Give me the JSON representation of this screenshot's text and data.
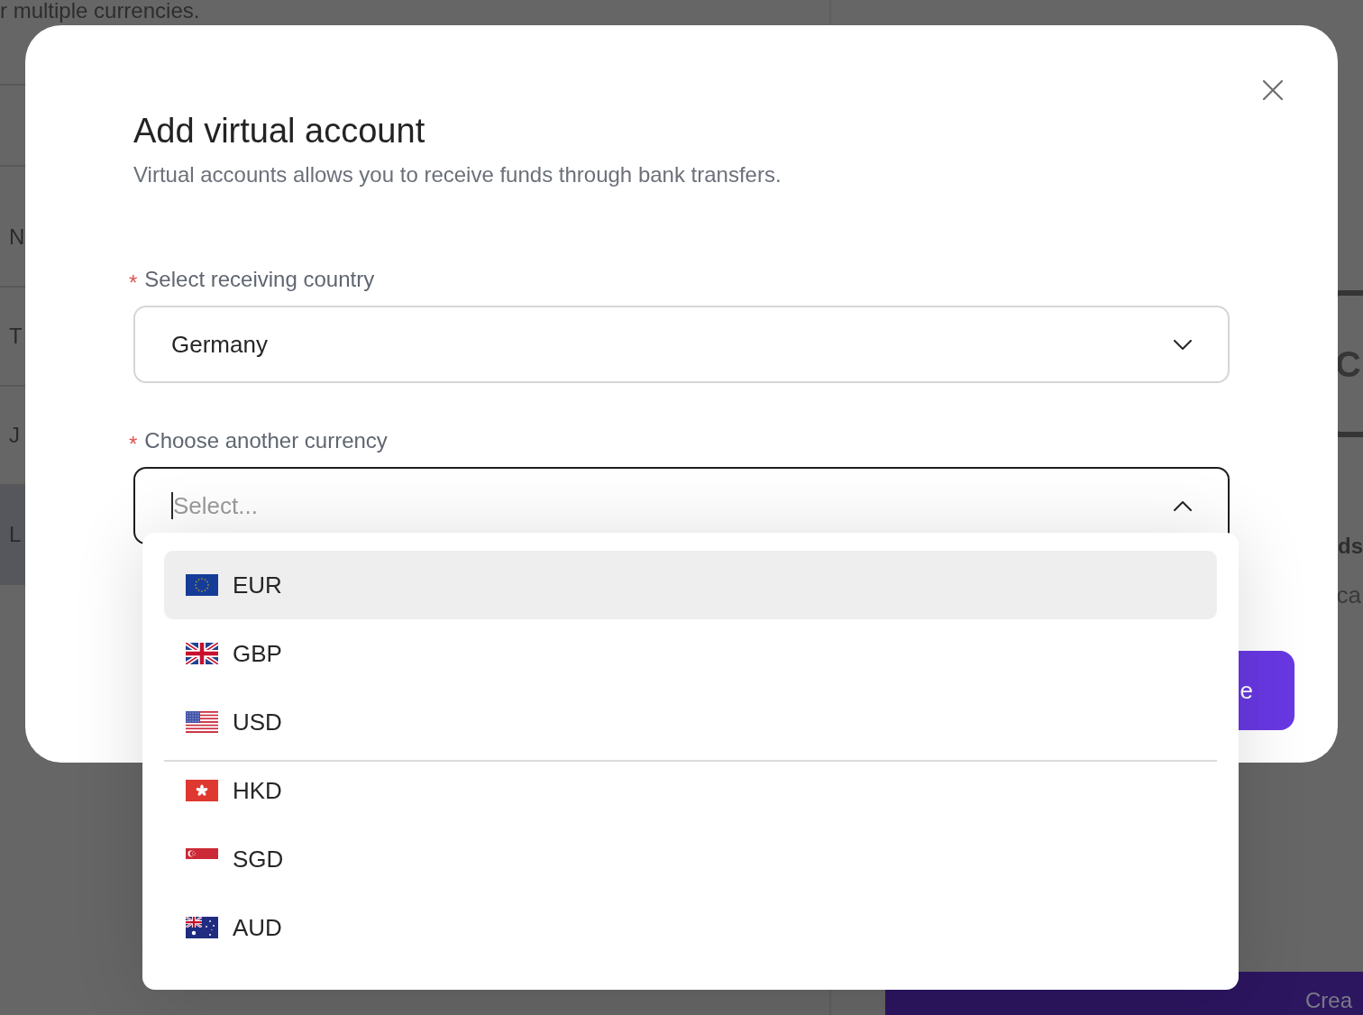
{
  "background": {
    "intro_text": "r multiple currencies.",
    "table_rows": [
      {
        "cell": "N",
        "selected": false
      },
      {
        "cell": "T",
        "selected": false
      },
      {
        "cell": "J",
        "selected": false
      },
      {
        "cell": "L",
        "selected": true
      }
    ],
    "side_panel": {
      "card_letter": "C",
      "heading": "ds",
      "text": "ca",
      "button": {
        "label": "Crea"
      }
    }
  },
  "modal": {
    "title": "Add virtual account",
    "subtitle": "Virtual accounts allows you to receive funds through bank transfers.",
    "fields": [
      {
        "required_mark": "*",
        "label": "Select receiving country",
        "value": "Germany",
        "focused": false,
        "expanded": false
      },
      {
        "required_mark": "*",
        "label": "Choose another currency",
        "placeholder": "Select...",
        "focused": true,
        "expanded": true,
        "dropdown": {
          "groups": [
            {
              "options": [
                {
                  "kind": "eu",
                  "code": "EUR",
                  "selected": true
                },
                {
                  "kind": "uk",
                  "code": "GBP",
                  "selected": false
                },
                {
                  "kind": "us",
                  "code": "USD",
                  "selected": false
                }
              ]
            },
            {
              "options": [
                {
                  "kind": "hk",
                  "code": "HKD",
                  "selected": false
                },
                {
                  "kind": "sg",
                  "code": "SGD",
                  "selected": false
                },
                {
                  "kind": "au",
                  "code": "AUD",
                  "selected": false
                }
              ]
            }
          ]
        }
      }
    ],
    "submit_button": {
      "label": "e"
    }
  }
}
